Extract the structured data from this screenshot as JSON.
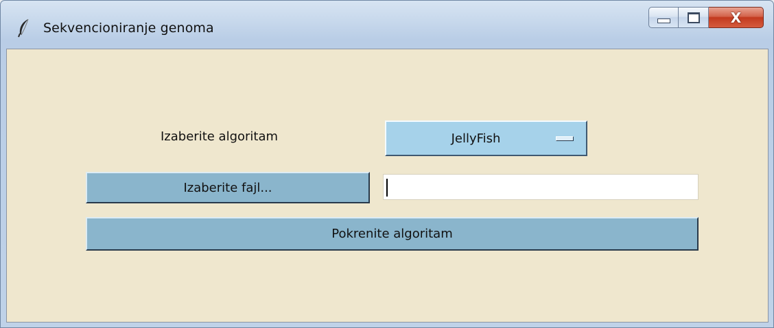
{
  "window": {
    "title": "Sekvencioniranje genoma",
    "icon": "feather-icon",
    "controls": {
      "minimize_icon": "minimize-icon",
      "maximize_icon": "maximize-icon",
      "close_glyph": "X"
    }
  },
  "form": {
    "algorithm_label": "Izaberite algoritam",
    "algorithm_selected": "JellyFish",
    "file_button_label": "Izaberite fajl...",
    "file_path_value": "",
    "run_button_label": "Pokrenite algoritam"
  },
  "colors": {
    "client_background": "#efe7ce",
    "select_background": "#a6d2ea",
    "button_background": "#8ab5cc",
    "close_button": "#c23a1f"
  }
}
